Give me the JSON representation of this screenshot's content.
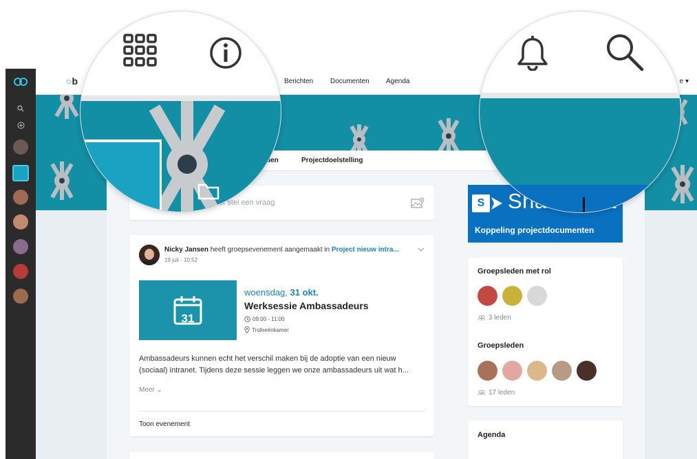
{
  "topbar": {
    "brand": "b",
    "nav": [
      "Berichten",
      "Documenten",
      "Agenda"
    ],
    "user_menu": "e ▾"
  },
  "tabs": [
    "den",
    "Projectdoelstelling"
  ],
  "composer": {
    "placeholder": "of stel een vraag"
  },
  "post": {
    "author": "Nicky Jansen",
    "action": " heeft groepsevenement aangemaakt in ",
    "group": "Project nieuw intra...",
    "time": "19 juli - 10:52",
    "event": {
      "calendar_day": "31",
      "weekday": "woensdag,",
      "date": "31 okt.",
      "title": "Werksessie Ambassadeurs",
      "time": "09:00 - 11:00",
      "location": "Trofeeënkamer"
    },
    "text": "Ambassadeurs kunnen echt het verschil maken bij de adoptie van een nieuw (sociaal) intranet. Tijdens deze sessie leggen we onze ambassadeurs uit wat h...",
    "more": "Meer",
    "show_event": "Toon evenement"
  },
  "sharepoint": {
    "logo_letter": "S",
    "word": "SharePoint",
    "caption": "Koppeling projectdocumenten"
  },
  "members": {
    "roles_heading": "Groepsleden met rol",
    "roles_count": "3 leden",
    "members_heading": "Groepsleden",
    "members_count": "17 leden"
  },
  "agenda": {
    "heading": "Agenda"
  },
  "colors": {
    "accent": "#128ea5",
    "link": "#1785a8",
    "sharepoint": "#0a70c0",
    "rail": "#2b2b2b"
  },
  "icons": [
    "apps-grid-icon",
    "info-icon",
    "bell-icon",
    "search-icon",
    "plus-circle-icon",
    "folder-icon",
    "photo-icon",
    "calendar-icon",
    "clock-icon",
    "location-icon",
    "chevron-down-icon",
    "people-icon"
  ]
}
